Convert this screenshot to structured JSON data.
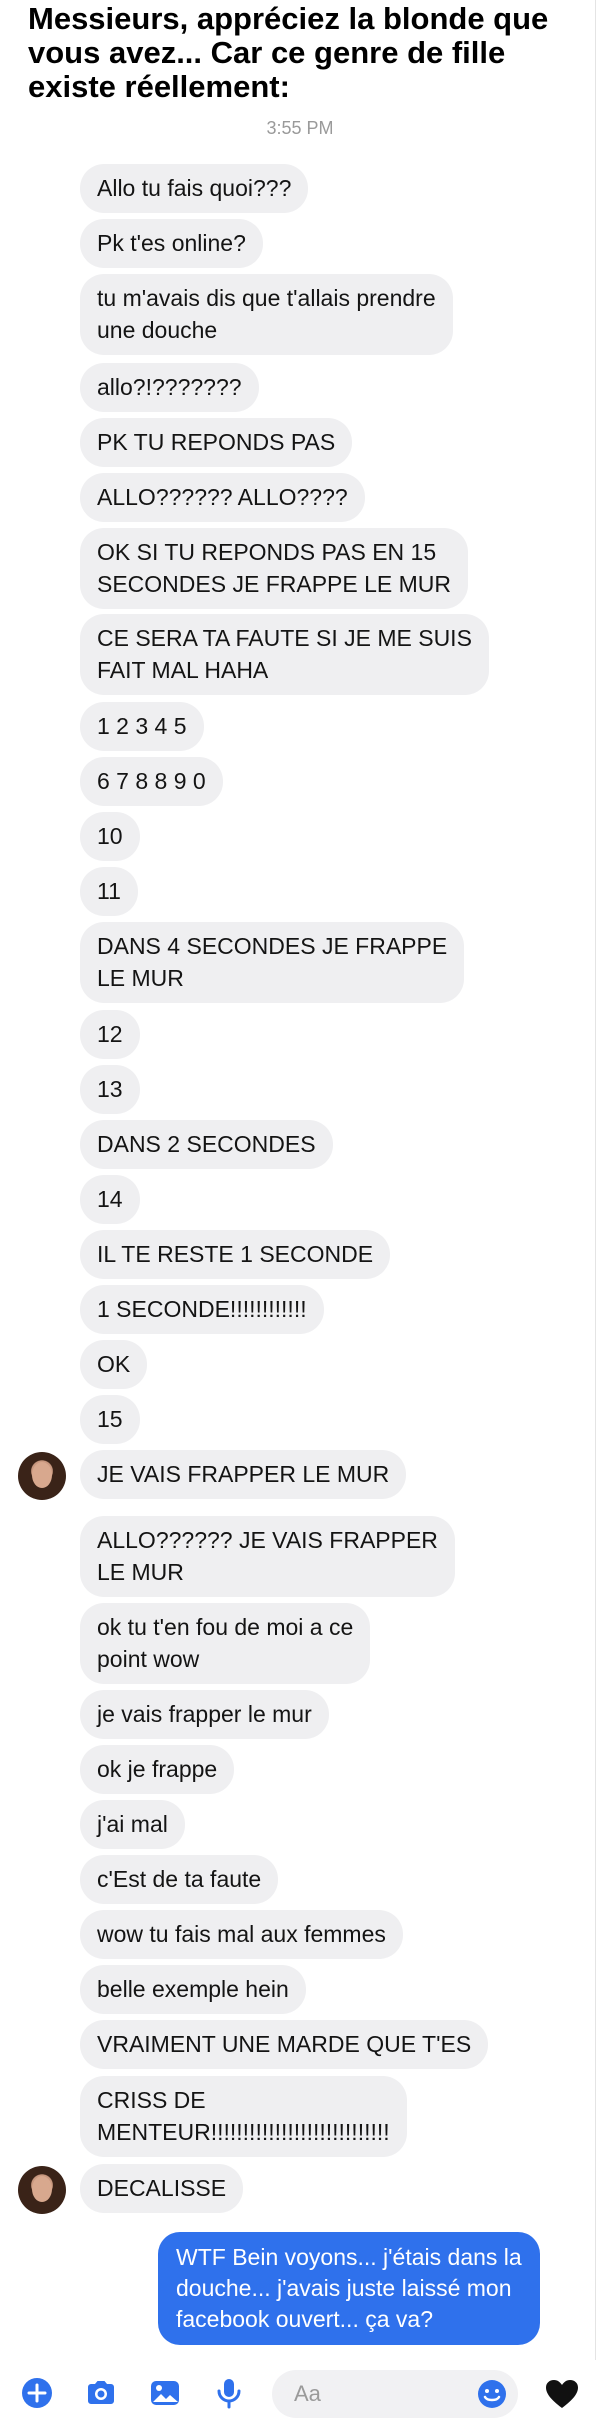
{
  "caption": "Messieurs, appréciez la blonde que vous avez... Car ce genre de fille existe réellement:",
  "timestamp": "3:55 PM",
  "messages": [
    {
      "text": "Allo tu fais quoi???"
    },
    {
      "text": "Pk t'es online?"
    },
    {
      "line1": "tu m'avais dis que t'allais prendre",
      "line2": "une douche"
    },
    {
      "text": "allo?!???????"
    },
    {
      "text": "PK TU REPONDS PAS"
    },
    {
      "text": "ALLO?????? ALLO????"
    },
    {
      "line1": "OK SI TU REPONDS PAS EN 15",
      "line2": "SECONDES JE FRAPPE LE MUR"
    },
    {
      "line1": "CE SERA TA FAUTE SI JE ME SUIS",
      "line2": "FAIT MAL HAHA"
    },
    {
      "text": "1 2 3 4 5"
    },
    {
      "text": "6 7 8 8 9 0"
    },
    {
      "text": "10"
    },
    {
      "text": "11"
    },
    {
      "line1": "DANS 4 SECONDES JE FRAPPE",
      "line2": "LE MUR"
    },
    {
      "text": "12"
    },
    {
      "text": "13"
    },
    {
      "text": "DANS 2 SECONDES"
    },
    {
      "text": "14"
    },
    {
      "text": "IL TE RESTE 1 SECONDE"
    },
    {
      "text": "1 SECONDE!!!!!!!!!!!!"
    },
    {
      "text": "OK"
    },
    {
      "text": "15"
    },
    {
      "text": "JE VAIS FRAPPER LE MUR"
    },
    {
      "line1": "ALLO?????? JE VAIS FRAPPER",
      "line2": "LE MUR"
    },
    {
      "line1": "ok tu t'en fou de moi a ce",
      "line2": "point wow"
    },
    {
      "text": "je vais frapper le mur"
    },
    {
      "text": "ok je frappe"
    },
    {
      "text": "j'ai mal"
    },
    {
      "text": "c'Est de ta faute"
    },
    {
      "text": "wow tu fais mal aux femmes"
    },
    {
      "text": "belle exemple hein"
    },
    {
      "text": "VRAIMENT UNE MARDE QUE T'ES"
    },
    {
      "line1": "CRISS DE",
      "line2": "MENTEUR!!!!!!!!!!!!!!!!!!!!!!!!!!!!"
    },
    {
      "text": "DECALISSE"
    }
  ],
  "reply": {
    "line1": "WTF Bein voyons... j'étais dans la",
    "line2": "douche... j'avais juste laissé mon",
    "line3": "facebook ouvert... ça va?"
  },
  "composer": {
    "placeholder": "Aa"
  },
  "colors": {
    "outgoing": "#2f71ec",
    "incoming": "#efeff1",
    "toolbar_icon": "#2f71ec"
  },
  "toolbar_icons": [
    "plus-icon",
    "camera-icon",
    "image-icon",
    "microphone-icon",
    "emoji-icon",
    "heart-icon"
  ]
}
